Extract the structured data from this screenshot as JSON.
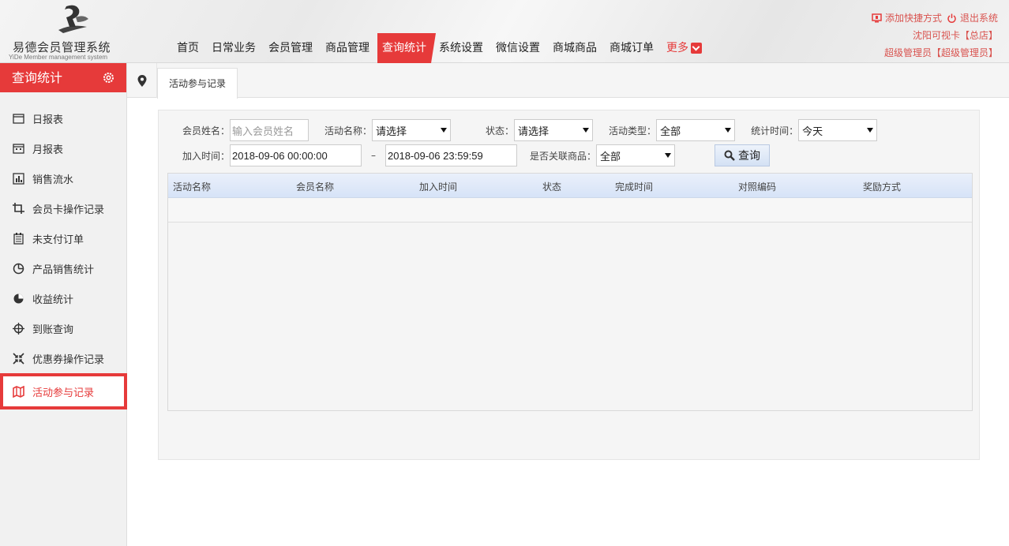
{
  "brand": {
    "title": "易德会员管理系统",
    "subtitle": "YiDe Member management system"
  },
  "nav": {
    "items": [
      "首页",
      "日常业务",
      "会员管理",
      "商品管理",
      "查询统计",
      "系统设置",
      "微信设置",
      "商城商品",
      "商城订单"
    ],
    "active": "查询统计",
    "more_label": "更多"
  },
  "top_right": {
    "add_shortcut": "添加快捷方式",
    "logout": "退出系统",
    "store": "沈阳可视卡【总店】",
    "user": "超级管理员【超级管理员】"
  },
  "sidebar": {
    "title": "查询统计",
    "items": [
      {
        "label": "日报表",
        "icon": "calendar-icon"
      },
      {
        "label": "月报表",
        "icon": "calendar-month-icon"
      },
      {
        "label": "销售流水",
        "icon": "bar-chart-icon"
      },
      {
        "label": "会员卡操作记录",
        "icon": "crop-icon"
      },
      {
        "label": "未支付订单",
        "icon": "receipt-icon"
      },
      {
        "label": "产品销售统计",
        "icon": "pie-chart-icon"
      },
      {
        "label": "收益统计",
        "icon": "half-circle-icon"
      },
      {
        "label": "到账查询",
        "icon": "crosshair-icon"
      },
      {
        "label": "优惠券操作记录",
        "icon": "shrink-icon"
      },
      {
        "label": "活动参与记录",
        "icon": "map-icon"
      }
    ],
    "active_index": 9
  },
  "tab": {
    "label": "活动参与记录"
  },
  "filters": {
    "member_name_label": "会员姓名：",
    "member_name_placeholder": "输入会员姓名",
    "activity_name_label": "活动名称：",
    "activity_name_value": "请选择",
    "status_label": "状态：",
    "status_value": "请选择",
    "activity_type_label": "活动类型：",
    "activity_type_value": "全部",
    "stat_time_label": "统计时间：",
    "stat_time_value": "今天",
    "join_time_label": "加入时间：",
    "join_time_start": "2018-09-06 00:00:00",
    "join_time_sep": "–",
    "join_time_end": "2018-09-06 23:59:59",
    "linked_goods_label": "是否关联商品：",
    "linked_goods_value": "全部",
    "query_button": "查询"
  },
  "table": {
    "columns": [
      "活动名称",
      "会员名称",
      "加入时间",
      "状态",
      "完成时间",
      "对照编码",
      "奖励方式"
    ],
    "rows": []
  },
  "colors": {
    "accent": "#e63a3a",
    "header_grad_top": "#eaf0fb"
  }
}
